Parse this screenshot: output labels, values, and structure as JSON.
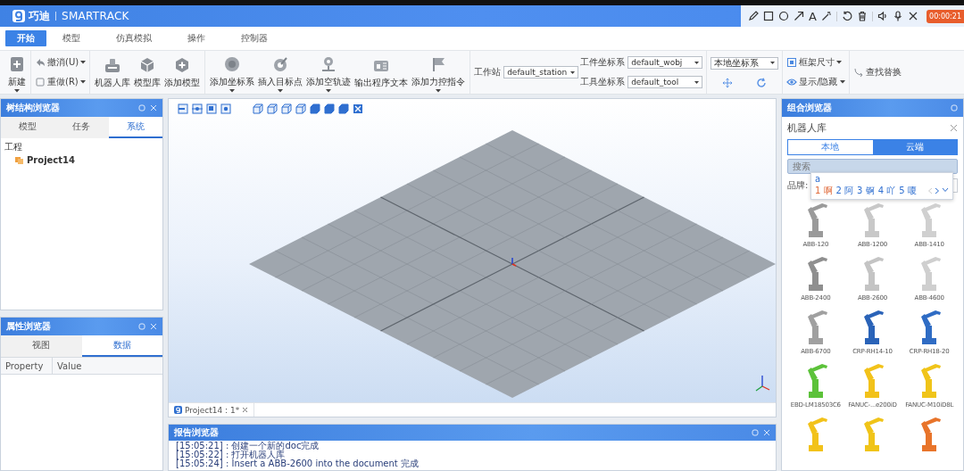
{
  "title_bar": {
    "logo": "巧迪",
    "app_name": "SMARTRACK"
  },
  "recorder": {
    "text_tool": "A",
    "timer": "00:00:21"
  },
  "menu_tabs": [
    {
      "label": "开始",
      "selected": true
    },
    {
      "label": "模型",
      "selected": false
    },
    {
      "label": "仿真模拟",
      "selected": false
    },
    {
      "label": "操作",
      "selected": false
    },
    {
      "label": "控制器",
      "selected": false
    }
  ],
  "ribbon": [
    {
      "columns": [
        [
          {
            "kind": "large",
            "label": "新建",
            "menu": true
          }
        ]
      ]
    },
    {
      "columns": [
        [
          {
            "kind": "small",
            "label": "撤消(U)",
            "menu": true
          },
          {
            "kind": "small",
            "label": "重做(R)",
            "menu": true
          }
        ]
      ]
    },
    {
      "columns": [
        [
          {
            "kind": "large",
            "label": "机器人库",
            "menu": false
          }
        ],
        [
          {
            "kind": "large",
            "label": "模型库",
            "menu": false
          }
        ],
        [
          {
            "kind": "large",
            "label": "添加模型",
            "menu": false
          }
        ]
      ]
    },
    {
      "columns": [
        [
          {
            "kind": "large",
            "label": "添加坐标系",
            "menu": true
          }
        ],
        [
          {
            "kind": "large",
            "label": "插入目标点",
            "menu": true
          }
        ],
        [
          {
            "kind": "large",
            "label": "添加空轨迹",
            "menu": true
          }
        ],
        [
          {
            "kind": "large",
            "label": "输出程序文本",
            "menu": false
          }
        ],
        [
          {
            "kind": "large",
            "label": "添加力控指令",
            "menu": true
          }
        ]
      ]
    },
    {
      "columns": [
        [
          {
            "kind": "select",
            "label": "工作站",
            "value": "default_station"
          }
        ],
        [
          {
            "kind": "select",
            "label": "工件坐标系",
            "value": "default_wobj"
          },
          {
            "kind": "select",
            "label": "工具坐标系",
            "value": "default_tool"
          }
        ]
      ]
    },
    {
      "columns": [
        [
          {
            "kind": "select",
            "value": "本地坐标系"
          },
          {
            "kind": "move"
          },
          {
            "kind": "refresh"
          }
        ]
      ]
    },
    {
      "columns": [
        [
          {
            "kind": "small",
            "label": "框架尺寸",
            "menu": true
          },
          {
            "kind": "small",
            "label": "显示/隐藏",
            "menu": true
          }
        ]
      ]
    },
    {
      "columns": [
        [
          {
            "kind": "small",
            "label": "查找替换",
            "menu": false
          }
        ]
      ]
    }
  ],
  "tree_browser": {
    "title": "树结构浏览器",
    "tabs": [
      {
        "label": "模型",
        "selected": false
      },
      {
        "label": "任务",
        "selected": false
      },
      {
        "label": "系统",
        "selected": true
      }
    ],
    "root": {
      "label": "工程",
      "children": [
        {
          "label": "Project14"
        }
      ]
    }
  },
  "property_browser": {
    "title": "属性浏览器",
    "tabs": [
      {
        "label": "视图",
        "selected": false
      },
      {
        "label": "数据",
        "selected": true
      }
    ],
    "columns": [
      "Property",
      "Value"
    ]
  },
  "viewport": {
    "document_tab": "Project14 : 1*"
  },
  "report_browser": {
    "title": "报告浏览器",
    "log": [
      "[15:05:21] : 创建一个新的doc完成",
      "[15:05:22] : 打开机器人库",
      "[15:05:24] : Insert a ABB-2600 into the document 完成"
    ]
  },
  "combined_browser": {
    "title": "组合浏览器",
    "library_title": "机器人库",
    "sources": [
      {
        "label": "本地",
        "selected": false
      },
      {
        "label": "云端",
        "selected": true
      }
    ],
    "search": {
      "placeholder": "搜索"
    },
    "brand_label": "品牌:",
    "ime": {
      "composition": "a",
      "candidates": [
        {
          "index": "1",
          "text": "啊",
          "selected": true
        },
        {
          "index": "2",
          "text": "阿",
          "selected": false
        },
        {
          "index": "3",
          "text": "锕",
          "selected": false
        },
        {
          "index": "4",
          "text": "吖",
          "selected": false
        },
        {
          "index": "5",
          "text": "嗄",
          "selected": false
        }
      ]
    },
    "robots": [
      {
        "name": "ABB-120",
        "color": "#9a9a9a"
      },
      {
        "name": "ABB-1200",
        "color": "#c8c8c8"
      },
      {
        "name": "ABB-1410",
        "color": "#d0d0d0"
      },
      {
        "name": "ABB-2400",
        "color": "#8f8f8f"
      },
      {
        "name": "ABB-2600",
        "color": "#c4c4c4"
      },
      {
        "name": "ABB-4600",
        "color": "#cfcfcf"
      },
      {
        "name": "ABB-6700",
        "color": "#a0a0a0"
      },
      {
        "name": "CRP-RH14-10",
        "color": "#2a63b8"
      },
      {
        "name": "CRP-RH18-20",
        "color": "#2f6cc4"
      },
      {
        "name": "EBD-LM18503C6",
        "color": "#5cc23a"
      },
      {
        "name": "FANUC-...e200iD",
        "color": "#f2c21a"
      },
      {
        "name": "FANUC-M10iD8L",
        "color": "#f0c419"
      },
      {
        "color": "#f2c21a"
      },
      {
        "color": "#f0c419"
      },
      {
        "color": "#e8742a"
      }
    ]
  }
}
